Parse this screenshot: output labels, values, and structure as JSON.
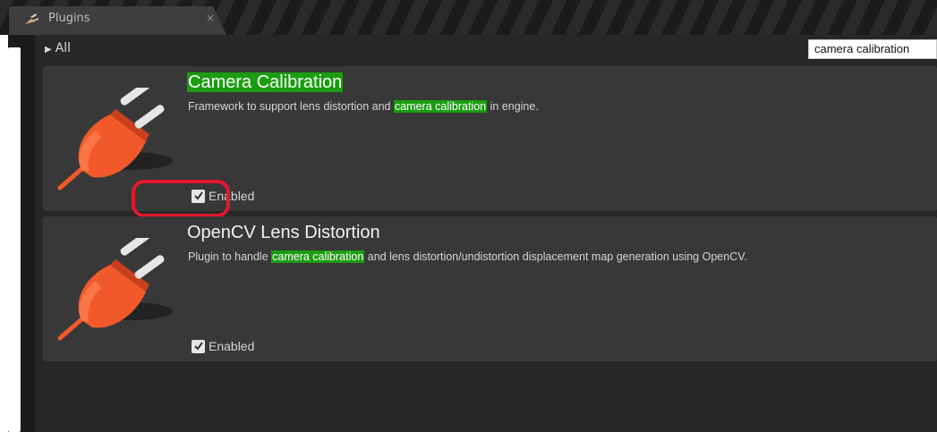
{
  "tab": {
    "label": "Plugins",
    "close": "×"
  },
  "category": {
    "label": "All",
    "arrow": "▶"
  },
  "search": {
    "value": "camera calibration"
  },
  "plugins": [
    {
      "title": "Camera Calibration",
      "desc_before": "Framework to support lens distortion and ",
      "desc_highlight": "camera calibration",
      "desc_after": " in engine.",
      "enabled_label": "Enabled",
      "enabled": true
    },
    {
      "title": "OpenCV Lens Distortion",
      "desc_before": "Plugin to handle ",
      "desc_highlight": "camera calibration",
      "desc_after": " and lens distortion/undistortion displacement map generation using OpenCV.",
      "enabled_label": "Enabled",
      "enabled": true
    }
  ],
  "colors": {
    "highlight": "#1b9d11",
    "annotation_ring": "#e3182c",
    "plug": "#f2592a"
  },
  "icons": {
    "tab": "plug-icon",
    "plugin": "plugin-plug-icon",
    "checkbox": "checkmark-icon"
  }
}
